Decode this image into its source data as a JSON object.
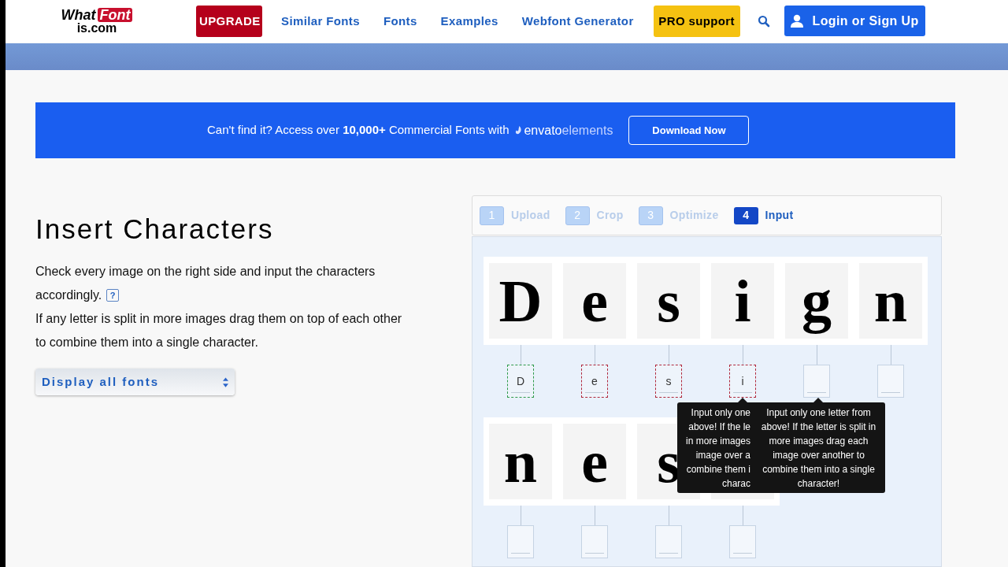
{
  "header": {
    "logo": {
      "part_1": "What",
      "part_2": "Font",
      "part_3": "is.com"
    },
    "nav": [
      {
        "label": "UPGRADE",
        "kind": "upgrade"
      },
      {
        "label": "Similar Fonts",
        "kind": "link"
      },
      {
        "label": "Fonts",
        "kind": "link"
      },
      {
        "label": "Examples",
        "kind": "link"
      },
      {
        "label": "Webfont Generator",
        "kind": "link"
      },
      {
        "label": "PRO support",
        "kind": "pro"
      }
    ],
    "login_button": "Login or Sign Up"
  },
  "banner": {
    "text": "Can't find it? Access over **10,000+** Commercial Fonts with",
    "brand_1": "envato",
    "brand_2": "elements",
    "button": "Download Now"
  },
  "intro": {
    "title": "Insert Characters",
    "paragraph_1": [
      "Check every image on the right side and input the characters",
      "accordingly."
    ],
    "help": "?",
    "paragraph_2": "If any letter is split in more images drag them on top of each other to combine them into a single character.",
    "select": "Display all fonts"
  },
  "steps": [
    {
      "number": "1",
      "label": "Upload",
      "selected": false
    },
    {
      "number": "2",
      "label": "Crop",
      "selected": false
    },
    {
      "number": "3",
      "label": "Optimize",
      "selected": false
    },
    {
      "number": "4",
      "label": "Input",
      "selected": true
    }
  ],
  "glyph_rows": [
    [
      {
        "glyph": "D",
        "value": "D",
        "kind": "correct"
      },
      {
        "glyph": "e",
        "value": "e",
        "kind": "wrong"
      },
      {
        "glyph": "s",
        "value": "s",
        "kind": "wrong"
      },
      {
        "glyph": "i",
        "value": "i",
        "kind": "wrong"
      },
      {
        "glyph": "g",
        "kind": "empty"
      },
      {
        "glyph": "n",
        "kind": "empty"
      }
    ],
    [
      {
        "glyph": "n",
        "kind": "empty"
      },
      {
        "glyph": "e",
        "kind": "empty"
      },
      {
        "glyph": "s",
        "kind": "empty"
      },
      {
        "kind": "empty"
      }
    ]
  ],
  "tooltips": [
    {
      "lines": [
        "Input only one",
        "above! If the le",
        "in more images",
        "image over a",
        "combine them i",
        "charac"
      ]
    },
    {
      "text": "Input only one letter from above! If the letter is split in more images drag each image over another to combine them into a single character!"
    }
  ]
}
